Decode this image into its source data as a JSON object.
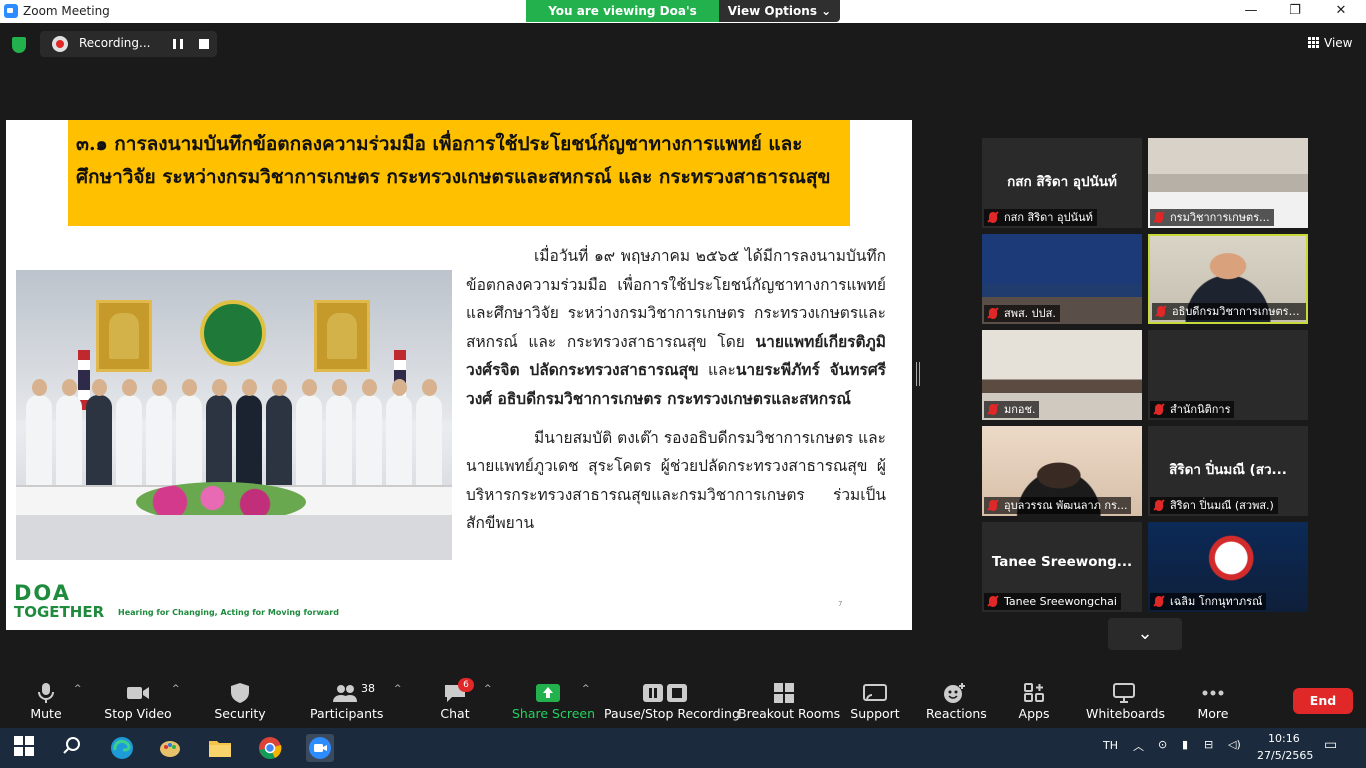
{
  "window": {
    "title": "Zoom Meeting",
    "minimize": "—",
    "maximize": "❐",
    "close": "✕"
  },
  "banner": {
    "viewing": "You are viewing Doa's screen",
    "view_options": "View Options ⌄"
  },
  "topbar": {
    "recording_label": "Recording...",
    "view_label": "View"
  },
  "slide": {
    "heading": "๓.๑ การลงนามบันทึกข้อตกลงความร่วมมือ เพื่อการใช้ประโยชน์กัญชาทางการแพทย์ และศึกษาวิจัย ระหว่างกรมวิชาการเกษตร กระทรวงเกษตรและสหกรณ์ และ กระทรวงสาธารณสุข",
    "para1_a": "เมื่อวันที่ ๑๙ พฤษภาคม ๒๕๖๕ ได้มีการลงนามบันทึกข้อตกลงความร่วมมือ เพื่อการใช้ประโยชน์กัญชาทางการแพทย์ และศึกษาวิจัย ระหว่างกรมวิชาการเกษตร กระทรวงเกษตรและสหกรณ์ และ กระทรวงสาธารณสุข โดย",
    "para1_b": "นายแพทย์เกียรติภูมิ วงศ์รจิต ปลัดกระทรวงสาธารณสุข",
    "para1_c": " และ",
    "para1_d": "นายระพีภัทร์ จันทรศรีวงศ์ อธิบดีกรมวิชาการเกษตร กระทรวงเกษตรและสหกรณ์",
    "para2": "มีนายสมบัติ ตงเต๊า รองอธิบดีกรมวิชาการเกษตร และ นายแพทย์ภูวเดช สุระโคตร ผู้ช่วยปลัดกระทรวงสาธารณสุข ผู้บริหารกระทรวงสาธารณสุขและกรมวิชาการเกษตร ร่วมเป็นสักขีพยาน",
    "logo_doa": "DOA",
    "logo_together": "TOGETHER",
    "tagline": "Hearing for Changing, Acting for Moving forward",
    "page_number": "7"
  },
  "participants": [
    {
      "big": "กสก สิริดา อุปนันท์",
      "name": "กสก สิริดา อุปนันท์",
      "video": false
    },
    {
      "big": "",
      "name": "กรมวิชาการเกษตร...",
      "video": true,
      "scene": "meeting-room"
    },
    {
      "big": "",
      "name": "สพส. ปปส.",
      "video": true,
      "scene": "banner"
    },
    {
      "big": "",
      "name": "อธิบดีกรมวิชาการเกษตร (...",
      "video": true,
      "scene": "speaker",
      "active": true
    },
    {
      "big": "",
      "name": "มกอช.",
      "video": true,
      "scene": "office"
    },
    {
      "big": "",
      "name": "สำนักนิติการ",
      "video": false
    },
    {
      "big": "",
      "name": "อุบลวรรณ พัฒนลาภ กร...",
      "video": true,
      "scene": "woman"
    },
    {
      "big": "สิริดา ปิ่นมณี (สว...",
      "name": "สิริดา ปิ่นมณี (สวพส.)",
      "video": false
    },
    {
      "big": "Tanee  Sreewong...",
      "name": "Tanee Sreewongchai",
      "video": false
    },
    {
      "big": "",
      "name": "เฉลิม โกกนุทาภรณ์",
      "video": true,
      "scene": "logo"
    }
  ],
  "toolbar": {
    "mute": "Mute",
    "stop_video": "Stop Video",
    "security": "Security",
    "participants": "Participants",
    "participants_count": "38",
    "chat": "Chat",
    "chat_badge": "6",
    "share_screen": "Share Screen",
    "pause_recording": "Pause/Stop Recording",
    "breakout": "Breakout Rooms",
    "support": "Support",
    "reactions": "Reactions",
    "apps": "Apps",
    "whiteboards": "Whiteboards",
    "more": "More",
    "end": "End"
  },
  "taskbar": {
    "lang": "TH",
    "time": "10:16",
    "date": "27/5/2565"
  },
  "colors": {
    "accent_green": "#23b14d",
    "end_red": "#e02828",
    "header_yellow": "#ffc000",
    "active_border": "#c8d93a"
  }
}
